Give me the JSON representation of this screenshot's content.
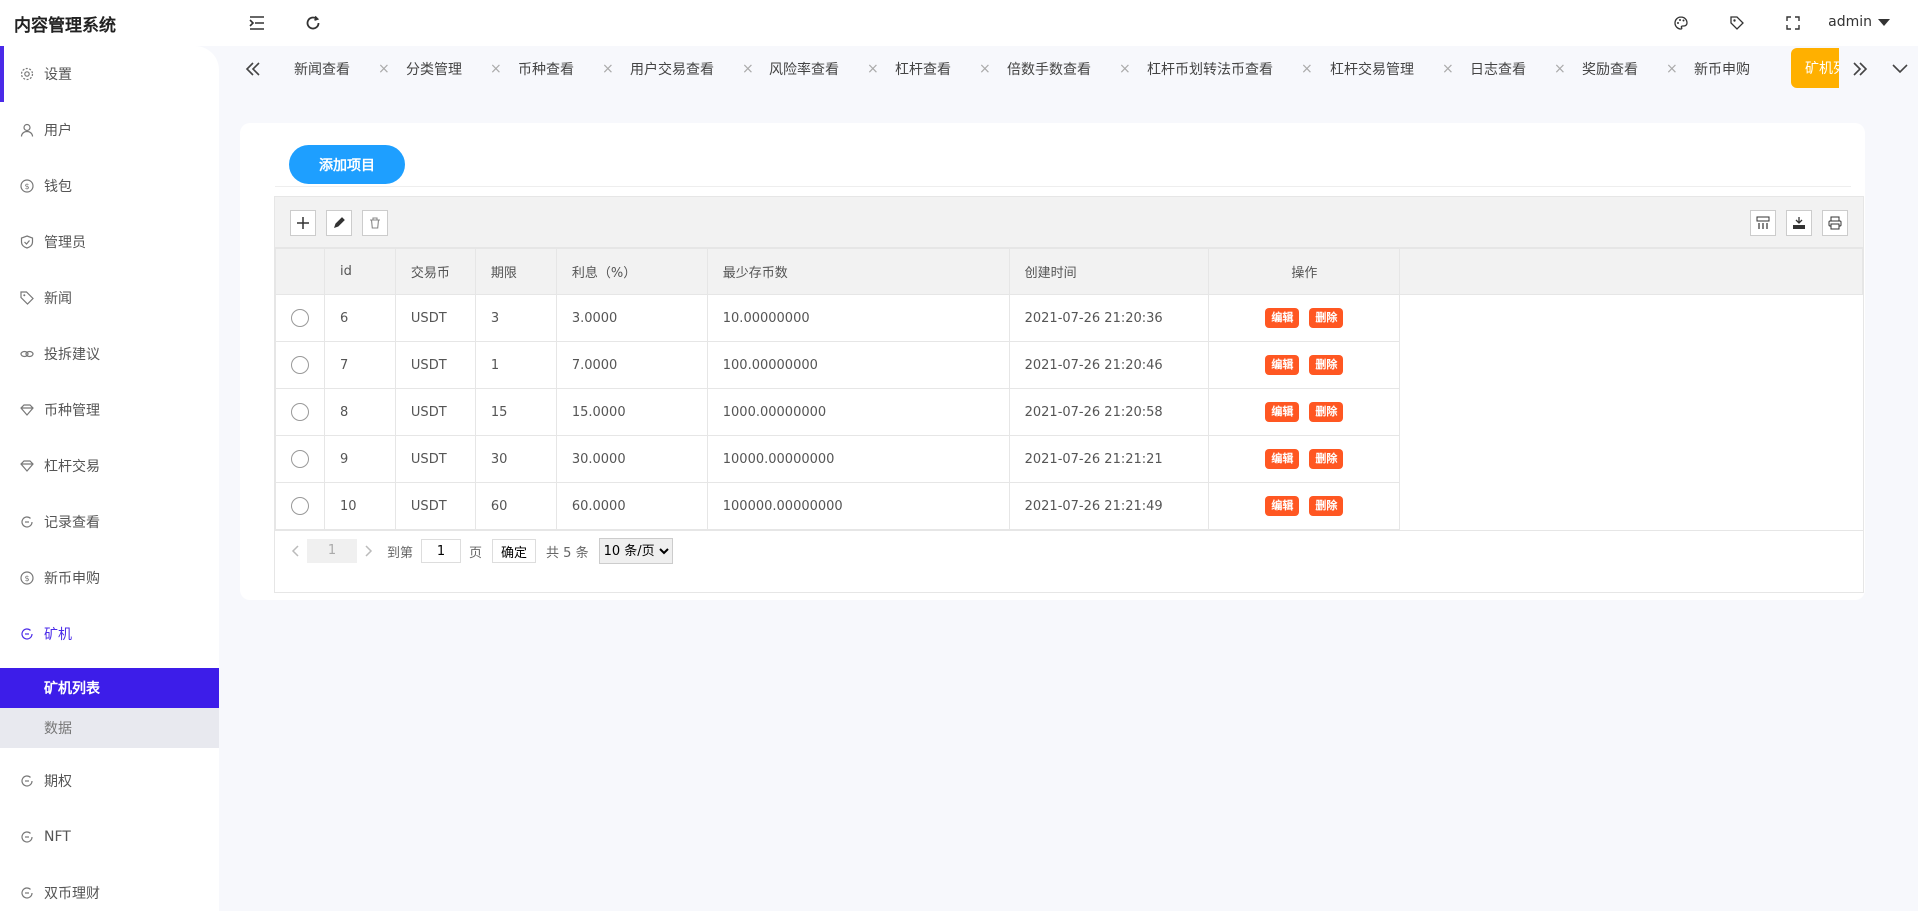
{
  "app": {
    "title": "内容管理系统",
    "user": "admin"
  },
  "header": {
    "icons": [
      "menu-fold-icon",
      "refresh-icon",
      "theme-palette-icon",
      "tag-icon",
      "fullscreen-icon"
    ]
  },
  "sidebar": {
    "items": [
      {
        "label": "设置",
        "icon": "gear-icon"
      },
      {
        "label": "用户",
        "icon": "user-icon"
      },
      {
        "label": "钱包",
        "icon": "coin-icon"
      },
      {
        "label": "管理员",
        "icon": "shield-icon"
      },
      {
        "label": "新闻",
        "icon": "tag-icon"
      },
      {
        "label": "投拆建议",
        "icon": "link-icon"
      },
      {
        "label": "币种管理",
        "icon": "diamond-icon"
      },
      {
        "label": "杠杆交易",
        "icon": "diamond-icon"
      },
      {
        "label": "记录查看",
        "icon": "circle-arrow-icon"
      },
      {
        "label": "新币申购",
        "icon": "coin-icon"
      },
      {
        "label": "矿机",
        "icon": "circle-arrow-icon"
      }
    ],
    "submenu": [
      {
        "label": "矿机列表"
      },
      {
        "label": "数据"
      }
    ],
    "items_after": [
      {
        "label": "期权",
        "icon": "circle-arrow-icon"
      },
      {
        "label": "NFT",
        "icon": "circle-arrow-icon"
      },
      {
        "label": "双币理财",
        "icon": "circle-arrow-icon"
      }
    ]
  },
  "tabs": {
    "items": [
      {
        "label": "新闻查看"
      },
      {
        "label": "分类管理"
      },
      {
        "label": "币种查看"
      },
      {
        "label": "用户交易查看"
      },
      {
        "label": "风险率查看"
      },
      {
        "label": "杠杆查看"
      },
      {
        "label": "倍数手数查看"
      },
      {
        "label": "杠杆币划转法币查看"
      },
      {
        "label": "杠杆交易管理"
      },
      {
        "label": "日志查看"
      },
      {
        "label": "奖励查看"
      },
      {
        "label": "新币申购"
      }
    ],
    "active_label": "矿机列表",
    "close_glyph": "×"
  },
  "main": {
    "add_button": "添加项目",
    "table": {
      "columns": [
        "id",
        "交易币",
        "期限",
        "利息（%）",
        "最少存币数",
        "创建时间",
        "操作"
      ],
      "rows": [
        {
          "id": "6",
          "coin": "USDT",
          "term": "3",
          "interest": "3.0000",
          "min": "10.00000000",
          "created": "2021-07-26 21:20:36"
        },
        {
          "id": "7",
          "coin": "USDT",
          "term": "1",
          "interest": "7.0000",
          "min": "100.00000000",
          "created": "2021-07-26 21:20:46"
        },
        {
          "id": "8",
          "coin": "USDT",
          "term": "15",
          "interest": "15.0000",
          "min": "1000.00000000",
          "created": "2021-07-26 21:20:58"
        },
        {
          "id": "9",
          "coin": "USDT",
          "term": "30",
          "interest": "30.0000",
          "min": "10000.00000000",
          "created": "2021-07-26 21:21:21"
        },
        {
          "id": "10",
          "coin": "USDT",
          "term": "60",
          "interest": "60.0000",
          "min": "100000.00000000",
          "created": "2021-07-26 21:21:49"
        }
      ],
      "edit_label": "编辑",
      "delete_label": "删除"
    },
    "pager": {
      "current": "1",
      "goto_label": "到第",
      "goto_value": "1",
      "page_unit": "页",
      "confirm": "确定",
      "total": "共 5 条",
      "page_size": "10 条/页"
    }
  },
  "colors": {
    "accent": "#3d1de9",
    "primary_button": "#1e9fff",
    "danger": "#ff5722",
    "active_tab": "#ffb000"
  }
}
